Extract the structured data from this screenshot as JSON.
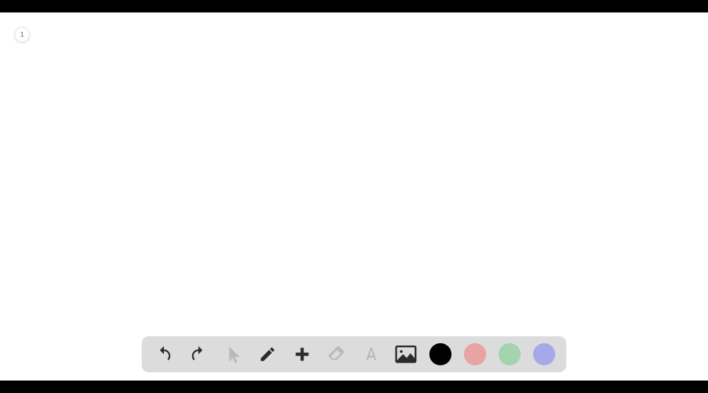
{
  "page_badge": {
    "label": "1"
  },
  "toolbar": {
    "tools": [
      {
        "name": "undo",
        "icon": "undo-icon",
        "enabled": true
      },
      {
        "name": "redo",
        "icon": "redo-icon",
        "enabled": true
      },
      {
        "name": "select",
        "icon": "cursor-icon",
        "enabled": false
      },
      {
        "name": "pencil",
        "icon": "pencil-icon",
        "enabled": true
      },
      {
        "name": "add",
        "icon": "plus-icon",
        "enabled": true
      },
      {
        "name": "eraser",
        "icon": "eraser-icon",
        "enabled": false
      },
      {
        "name": "text",
        "icon": "text-icon",
        "enabled": false
      },
      {
        "name": "image",
        "icon": "image-icon",
        "enabled": true
      }
    ],
    "colors": [
      {
        "name": "black",
        "hex": "#000000"
      },
      {
        "name": "red",
        "hex": "#e9a3a3"
      },
      {
        "name": "green",
        "hex": "#a3d4ad"
      },
      {
        "name": "blue",
        "hex": "#a7a8ea"
      }
    ]
  }
}
